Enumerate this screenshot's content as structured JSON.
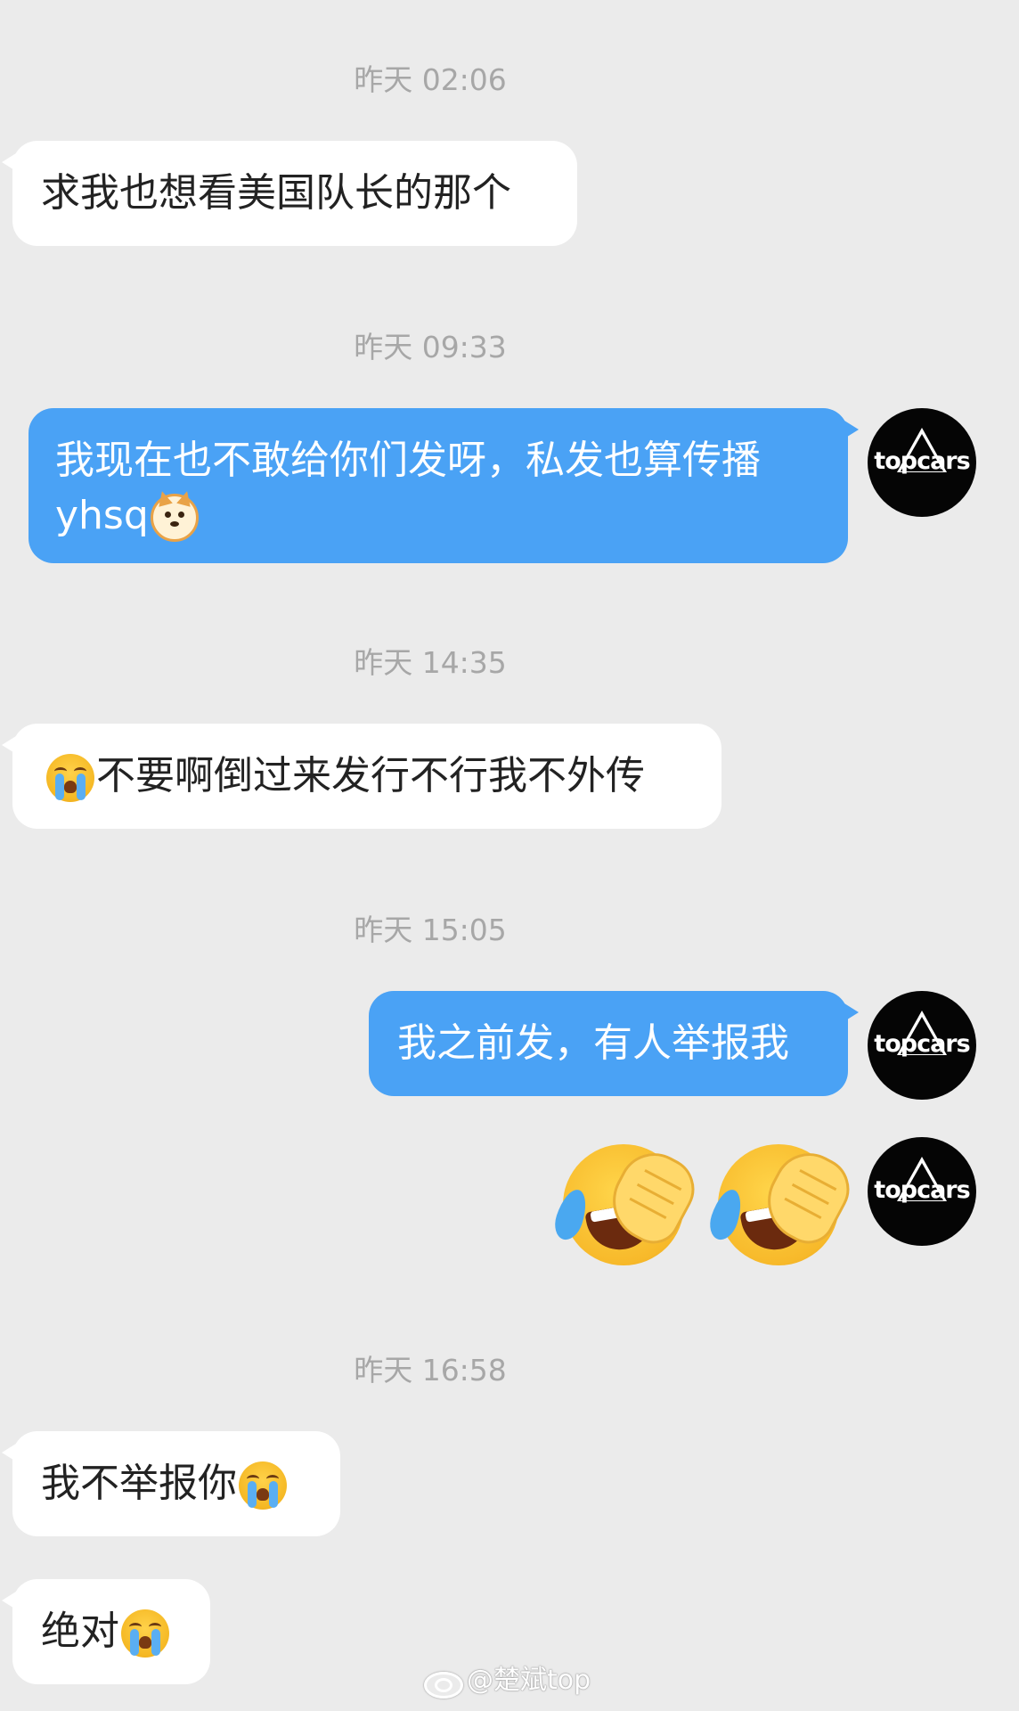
{
  "conversation": {
    "timestamps": [
      "昨天 02:06",
      "昨天 09:33",
      "昨天 14:35",
      "昨天 15:05",
      "昨天 16:58"
    ],
    "messages": [
      {
        "side": "in",
        "text": "求我也想看美国队长的那个"
      },
      {
        "side": "out",
        "line1": "我现在也不敢给你们发呀，私发也算传播",
        "line2": "yhsq",
        "emoji": "doge-icon"
      },
      {
        "side": "in",
        "emoji": "crying-face-icon",
        "text": "不要啊倒过来发行不行我不外传"
      },
      {
        "side": "out",
        "text": "我之前发，有人举报我"
      },
      {
        "side": "out",
        "emoji": "face-with-tears-of-joy-facepalm-icon"
      },
      {
        "side": "in",
        "text": "我不举报你",
        "emoji": "crying-face-icon"
      },
      {
        "side": "in",
        "text": "绝对",
        "emoji": "crying-face-icon"
      }
    ]
  },
  "avatar": {
    "brand": "topcars"
  },
  "watermark": {
    "text": "@楚斌top",
    "icon": "weibo-icon"
  },
  "colors": {
    "background": "#ebebeb",
    "outgoing_bubble": "#4aa2f5",
    "incoming_bubble": "#ffffff",
    "timestamp": "#a7a7a7"
  }
}
